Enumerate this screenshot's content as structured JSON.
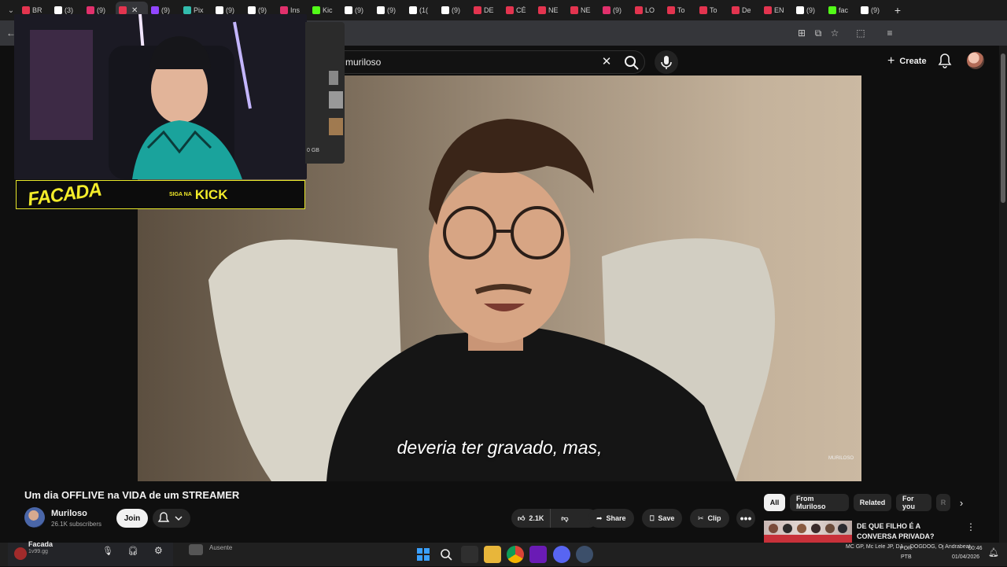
{
  "tabs": [
    {
      "label": "BR",
      "color": "#e3344f"
    },
    {
      "label": "(3)",
      "color": "#ffffff",
      "glyph": "X"
    },
    {
      "label": "(9)",
      "color": "#e1306c"
    },
    {
      "label": "",
      "color": "#e3344f",
      "active": true
    },
    {
      "label": "(9)",
      "color": "#9146ff"
    },
    {
      "label": "Pix",
      "color": "#32bcad"
    },
    {
      "label": "(9)",
      "color": "#ffffff"
    },
    {
      "label": "(9)",
      "color": "#ffffff"
    },
    {
      "label": "Ins",
      "color": "#e1306c"
    },
    {
      "label": "Kic",
      "color": "#53fc18"
    },
    {
      "label": "(9)",
      "color": "#ffffff"
    },
    {
      "label": "(9)",
      "color": "#ffffff"
    },
    {
      "label": "(1(",
      "color": "#ffffff",
      "glyph": "X"
    },
    {
      "label": "(9)",
      "color": "#ffffff"
    },
    {
      "label": "DE",
      "color": "#e3344f"
    },
    {
      "label": "CÉ",
      "color": "#e3344f"
    },
    {
      "label": "NE",
      "color": "#e3344f"
    },
    {
      "label": "NE",
      "color": "#e3344f"
    },
    {
      "label": "(9)",
      "color": "#e1306c"
    },
    {
      "label": "LO",
      "color": "#e3344f"
    },
    {
      "label": "To",
      "color": "#e3344f"
    },
    {
      "label": "To",
      "color": "#e3344f"
    },
    {
      "label": "De",
      "color": "#e3344f"
    },
    {
      "label": "EN",
      "color": "#e3344f"
    },
    {
      "label": "(9)",
      "color": "#ffffff"
    },
    {
      "label": "fac",
      "color": "#53fc18"
    },
    {
      "label": "(9)",
      "color": "#ffffff"
    }
  ],
  "search": {
    "query": "muriloso",
    "clear_icon": "close-icon",
    "search_icon": "search-icon",
    "mic_icon": "mic-icon"
  },
  "masthead": {
    "create_label": "Create"
  },
  "video": {
    "subtitle": "deveria ter gravado, mas,",
    "watermark": "MURILOSO"
  },
  "overlay": {
    "brand": "FACADA",
    "siga": "SIGA NA",
    "platform": "KICK",
    "popup_size": "0 GB"
  },
  "watch": {
    "title": "Um dia OFFLIVE na VIDA de um STREAMER",
    "channel_name": "Muriloso",
    "subscribers": "26.1K subscribers",
    "join_label": "Join",
    "likes": "2.1K",
    "share_label": "Share",
    "save_label": "Save",
    "clip_label": "Clip",
    "more_label": "•••"
  },
  "chips": [
    {
      "label": "All",
      "active": true
    },
    {
      "label": "From Muriloso",
      "active": false
    },
    {
      "label": "Related",
      "active": false
    },
    {
      "label": "For you",
      "active": false
    },
    {
      "label": "R",
      "active": false
    }
  ],
  "recommendation": {
    "title": "DE QUE FILHO É A CONVERSA PRIVADA?"
  },
  "discord": {
    "server": "Facada",
    "sub": "1v99.gg",
    "friend_status": "Ausente"
  },
  "tray": {
    "language": "POR",
    "layout": "PTB",
    "time": "00:46",
    "date": "01/04/2026",
    "now_playing": "MC GP, Mc Lele JP, DJ ... DOGDOG, Oj Andrabeat"
  },
  "colors": {
    "accent_yellow": "#f3ec2a",
    "youtube_bg": "#0f0f0f",
    "chip_bg": "#272727"
  }
}
